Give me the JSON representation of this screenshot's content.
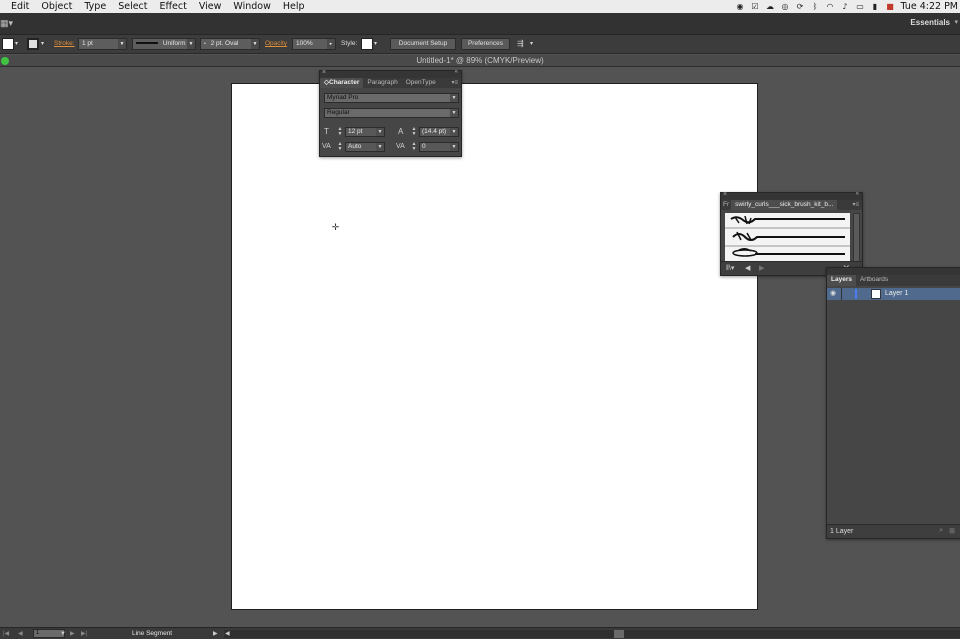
{
  "menubar": {
    "items": [
      "Edit",
      "Object",
      "Type",
      "Select",
      "Effect",
      "View",
      "Window",
      "Help"
    ],
    "clock": "Tue 4:22 PM"
  },
  "appbar": {
    "workspace": "Essentials"
  },
  "controlbar": {
    "stroke_label": "Stroke:",
    "stroke_weight": "1 pt",
    "profile": "Uniform",
    "brush": "2 pt. Oval",
    "opacity_label": "Opacity",
    "opacity": "100%",
    "style_label": "Style:",
    "document_setup": "Document Setup",
    "preferences": "Preferences"
  },
  "document": {
    "title": "Untitled-1* @ 89% (CMYK/Preview)"
  },
  "character_panel": {
    "tabs": [
      "Character",
      "Paragraph",
      "OpenType"
    ],
    "font_family": "Myriad Pro",
    "font_style": "Regular",
    "font_size": "12 pt",
    "leading": "(14.4 pt)",
    "kerning": "Auto",
    "tracking": "0"
  },
  "brushes_panel": {
    "tab_partial": "Fr",
    "tab_active": "swirly_curls___sick_brush_kit_b..."
  },
  "layers_panel": {
    "tabs": [
      "Layers",
      "Artboards"
    ],
    "layer_name": "Layer 1",
    "footer": "1 Layer"
  },
  "statusbar": {
    "page": "1",
    "tool": "Line Segment"
  }
}
